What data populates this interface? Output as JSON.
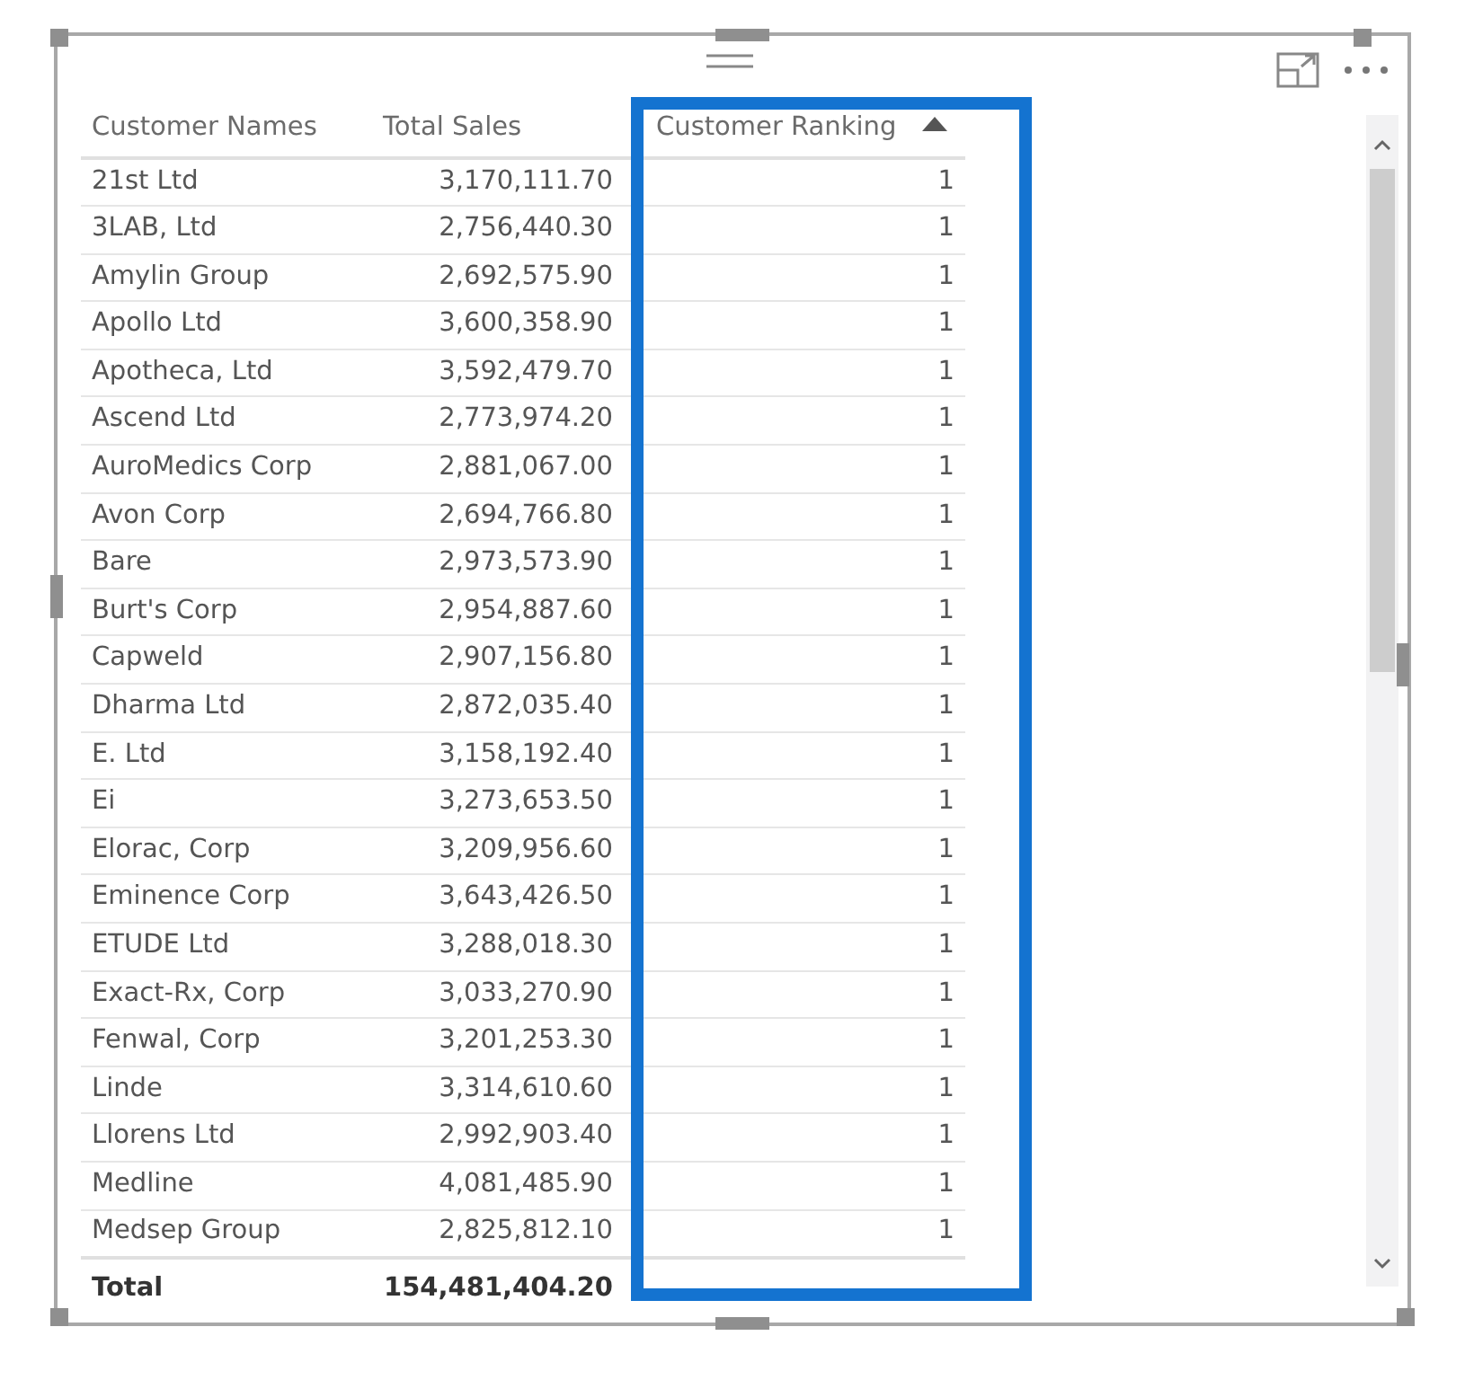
{
  "table": {
    "columns": [
      {
        "label": "Customer Names",
        "sorted": false
      },
      {
        "label": "Total Sales",
        "sorted": false
      },
      {
        "label": "Customer Ranking",
        "sorted": true
      }
    ],
    "rows": [
      [
        "21st Ltd",
        "3,170,111.70",
        "1"
      ],
      [
        "3LAB, Ltd",
        "2,756,440.30",
        "1"
      ],
      [
        "Amylin Group",
        "2,692,575.90",
        "1"
      ],
      [
        "Apollo Ltd",
        "3,600,358.90",
        "1"
      ],
      [
        "Apotheca, Ltd",
        "3,592,479.70",
        "1"
      ],
      [
        "Ascend Ltd",
        "2,773,974.20",
        "1"
      ],
      [
        "AuroMedics Corp",
        "2,881,067.00",
        "1"
      ],
      [
        "Avon Corp",
        "2,694,766.80",
        "1"
      ],
      [
        "Bare",
        "2,973,573.90",
        "1"
      ],
      [
        "Burt's Corp",
        "2,954,887.60",
        "1"
      ],
      [
        "Capweld",
        "2,907,156.80",
        "1"
      ],
      [
        "Dharma Ltd",
        "2,872,035.40",
        "1"
      ],
      [
        "E. Ltd",
        "3,158,192.40",
        "1"
      ],
      [
        "Ei",
        "3,273,653.50",
        "1"
      ],
      [
        "Elorac, Corp",
        "3,209,956.60",
        "1"
      ],
      [
        "Eminence Corp",
        "3,643,426.50",
        "1"
      ],
      [
        "ETUDE Ltd",
        "3,288,018.30",
        "1"
      ],
      [
        "Exact-Rx, Corp",
        "3,033,270.90",
        "1"
      ],
      [
        "Fenwal, Corp",
        "3,201,253.30",
        "1"
      ],
      [
        "Linde",
        "3,314,610.60",
        "1"
      ],
      [
        "Llorens Ltd",
        "2,992,903.40",
        "1"
      ],
      [
        "Medline",
        "4,081,485.90",
        "1"
      ],
      [
        "Medsep Group",
        "2,825,812.10",
        "1"
      ]
    ],
    "total": [
      "Total",
      "154,481,404.20"
    ]
  },
  "highlight": {
    "on": true
  }
}
